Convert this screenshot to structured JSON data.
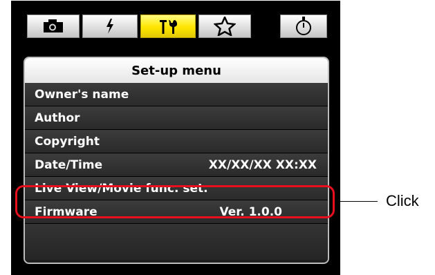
{
  "tabs": [
    {
      "icon": "camera-icon",
      "active": false
    },
    {
      "icon": "flash-icon",
      "active": false
    },
    {
      "icon": "tools-icon",
      "active": true
    },
    {
      "icon": "star-icon",
      "active": false
    },
    {
      "icon": "timer-icon",
      "active": false
    }
  ],
  "menu": {
    "title": "Set-up menu",
    "items": [
      {
        "label": "Owner's name",
        "value": ""
      },
      {
        "label": "Author",
        "value": ""
      },
      {
        "label": "Copyright",
        "value": ""
      },
      {
        "label": "Date/Time",
        "value": "XX/XX/XX XX:XX"
      },
      {
        "label": "Live View/Movie func. set.",
        "value": ""
      },
      {
        "label": "Firmware",
        "value": "Ver. 1.0.0"
      }
    ]
  },
  "callout": {
    "label": "Click",
    "color": "#e8101d"
  }
}
